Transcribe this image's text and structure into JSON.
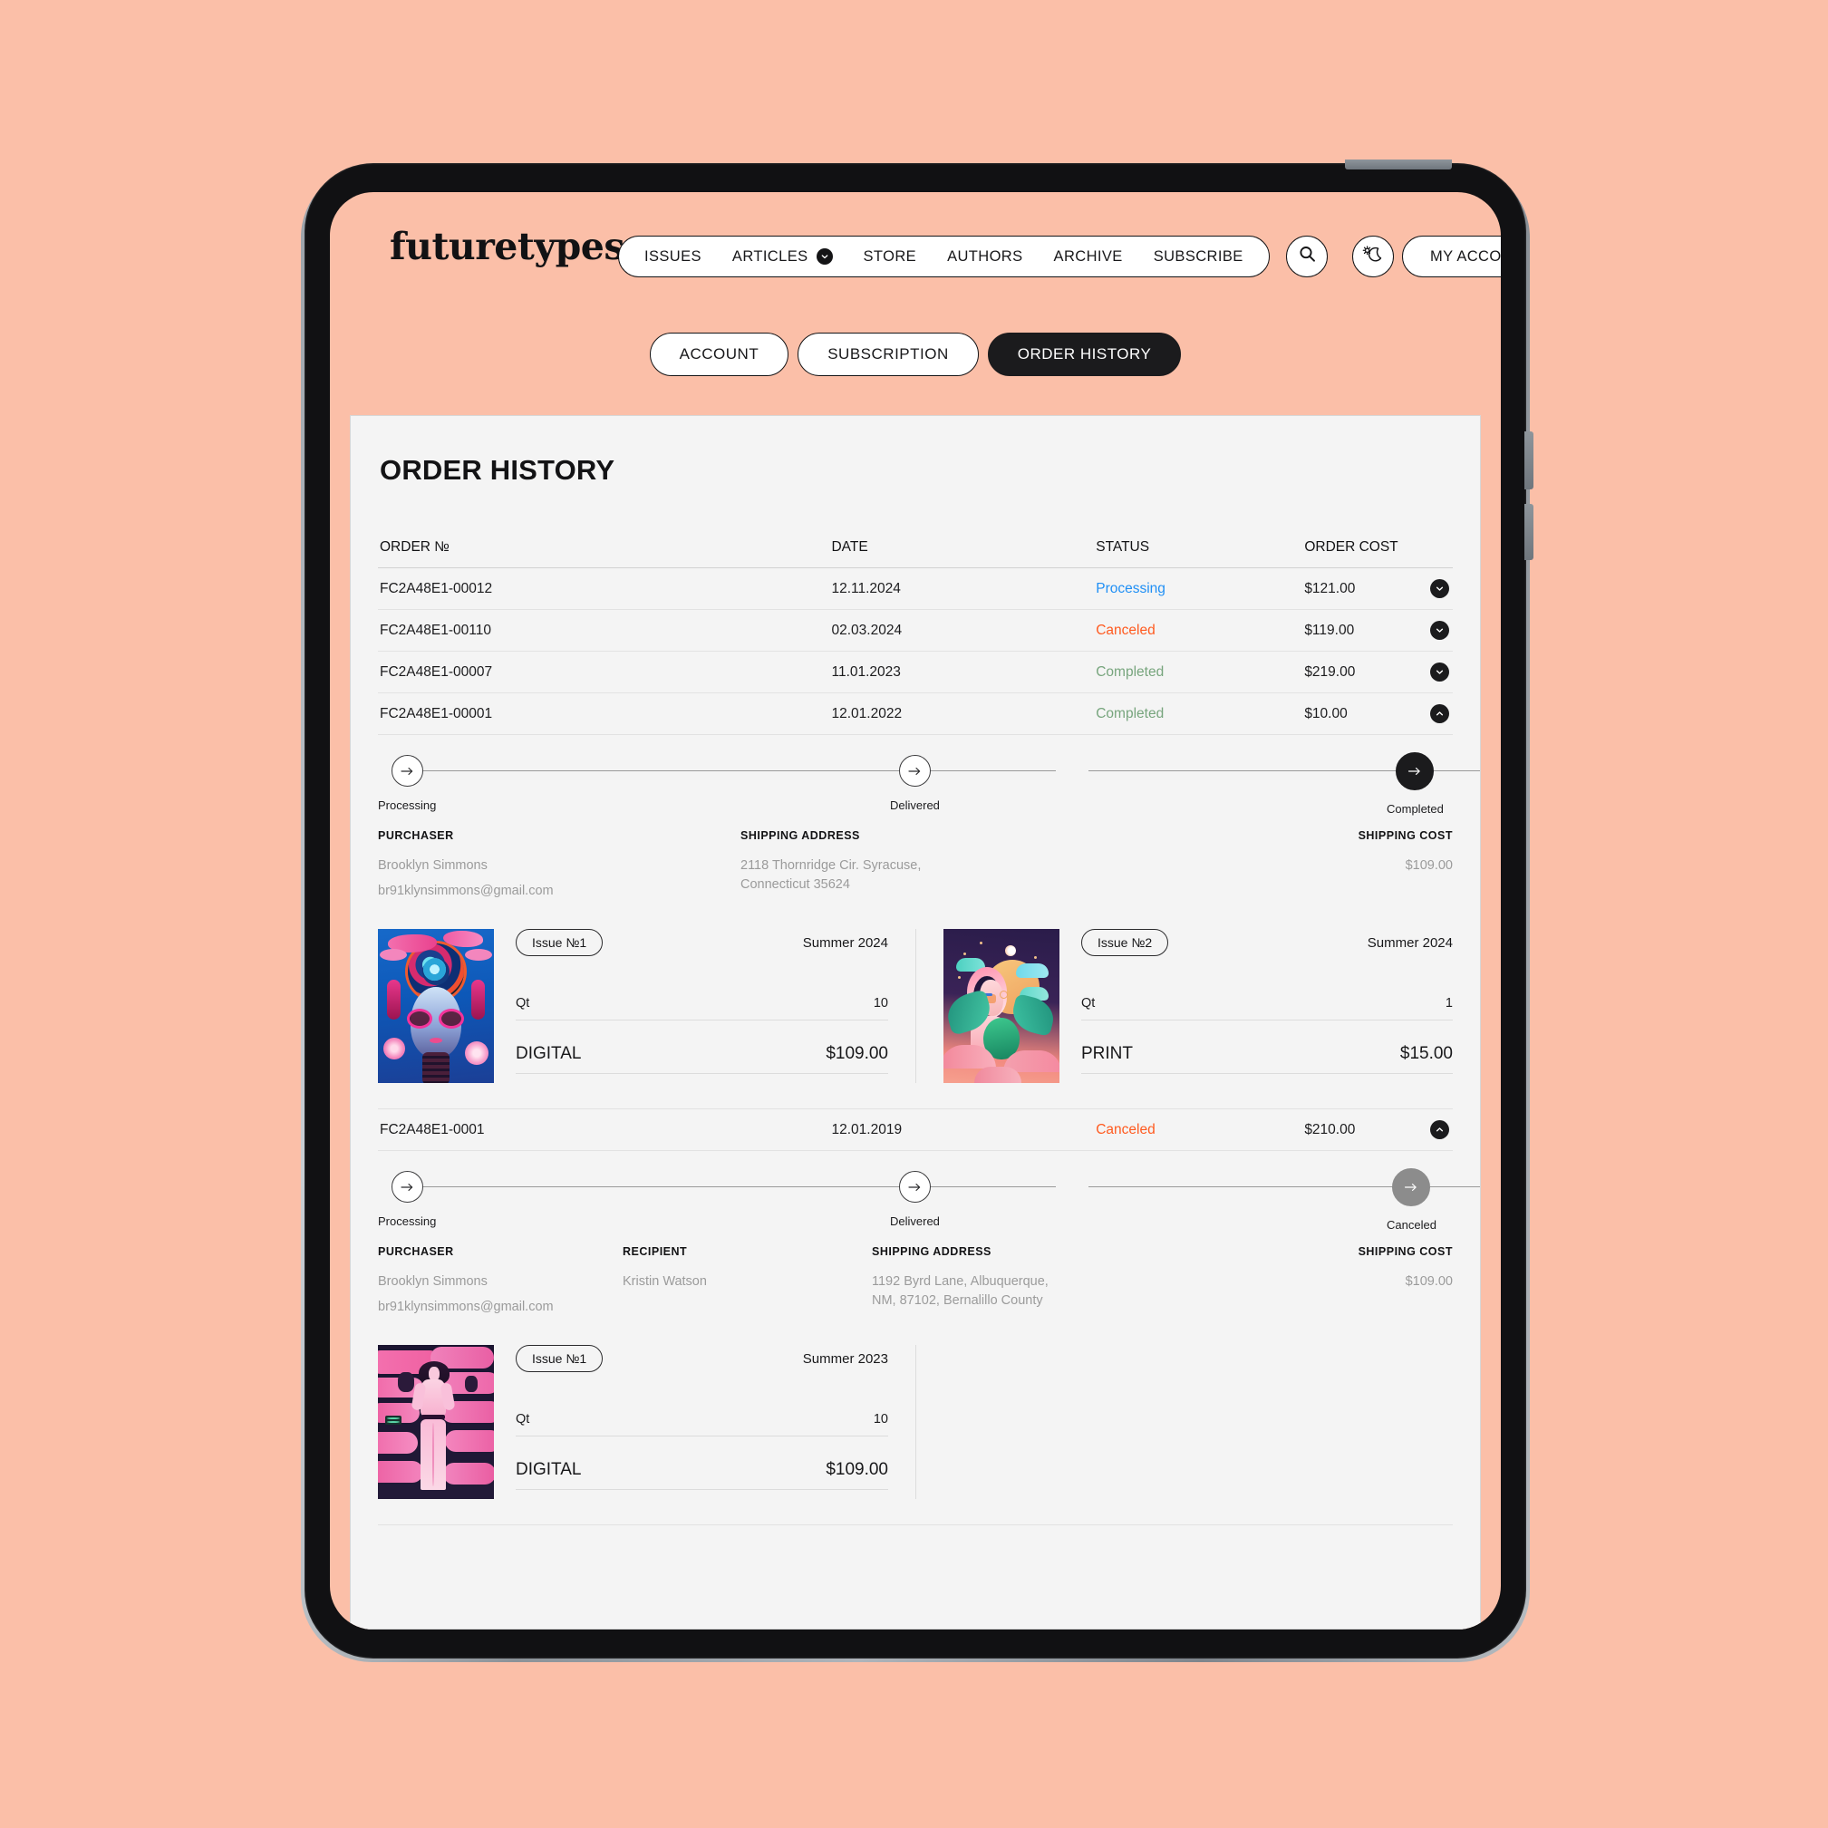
{
  "brand": "futuretypes",
  "nav": {
    "links": [
      {
        "label": "ISSUES",
        "has_chevron": false
      },
      {
        "label": "ARTICLES",
        "has_chevron": true
      },
      {
        "label": "STORE",
        "has_chevron": false
      },
      {
        "label": "AUTHORS",
        "has_chevron": false
      },
      {
        "label": "ARCHIVE",
        "has_chevron": false
      },
      {
        "label": "SUBSCRIBE",
        "has_chevron": false
      }
    ],
    "search_icon": "search-icon",
    "theme_icon": "sun-moon-icon",
    "account_label": "MY ACCOUNT"
  },
  "tabs": [
    {
      "label": "ACCOUNT",
      "active": false
    },
    {
      "label": "SUBSCRIPTION",
      "active": false
    },
    {
      "label": "ORDER HISTORY",
      "active": true
    }
  ],
  "page_title": "ORDER HISTORY",
  "table": {
    "headers": {
      "order": "ORDER №",
      "date": "DATE",
      "status": "STATUS",
      "cost": "ORDER COST"
    },
    "rows": [
      {
        "order": "FC2A48E1-00012",
        "date": "12.11.2024",
        "status": "Processing",
        "status_kind": "processing",
        "cost": "$121.00",
        "expanded": false
      },
      {
        "order": "FC2A48E1-00110",
        "date": "02.03.2024",
        "status": "Canceled",
        "status_kind": "canceled",
        "cost": "$119.00",
        "expanded": false
      },
      {
        "order": "FC2A48E1-00007",
        "date": "11.01.2023",
        "status": "Completed",
        "status_kind": "completed",
        "cost": "$219.00",
        "expanded": false
      },
      {
        "order": "FC2A48E1-00001",
        "date": "12.01.2022",
        "status": "Completed",
        "status_kind": "completed",
        "cost": "$10.00",
        "expanded": true
      },
      {
        "order": "FC2A48E1-0001",
        "date": "12.01.2019",
        "status": "Canceled",
        "status_kind": "canceled",
        "cost": "$210.00",
        "expanded": true
      }
    ]
  },
  "colors": {
    "background": "#fbbfa8",
    "card": "#f4f4f4",
    "ink": "#1b1b1d",
    "processing": "#1f8ff5",
    "canceled": "#ff5a1f",
    "completed": "#77a57d"
  },
  "details": [
    {
      "steps": [
        {
          "label": "Processing",
          "state": "outline"
        },
        {
          "label": "Delivered",
          "state": "outline"
        },
        {
          "label": "Completed",
          "state": "filled"
        }
      ],
      "meta": [
        {
          "label": "PURCHASER",
          "values": [
            "Brooklyn Simmons",
            "br91klynsimmons@gmail.com"
          ]
        },
        {
          "label": "SHIPPING ADDRESS",
          "values": [
            "2118 Thornridge Cir. Syracuse,",
            "Connecticut 35624"
          ]
        },
        {
          "label": "SHIPPING COST",
          "values": [
            "$109.00"
          ]
        }
      ],
      "items": [
        {
          "issue": "Issue №1",
          "season": "Summer 2024",
          "qt_label": "Qt",
          "qt": "10",
          "format": "DIGITAL",
          "price": "$109.00",
          "cover": "cov-a"
        },
        {
          "issue": "Issue №2",
          "season": "Summer 2024",
          "qt_label": "Qt",
          "qt": "1",
          "format": "PRINT",
          "price": "$15.00",
          "cover": "cov-b"
        }
      ]
    },
    {
      "steps": [
        {
          "label": "Processing",
          "state": "outline"
        },
        {
          "label": "Delivered",
          "state": "outline"
        },
        {
          "label": "Canceled",
          "state": "grey"
        }
      ],
      "meta": [
        {
          "label": "PURCHASER",
          "values": [
            "Brooklyn Simmons",
            "br91klynsimmons@gmail.com"
          ]
        },
        {
          "label": "RECIPIENT",
          "values": [
            "Kristin Watson"
          ]
        },
        {
          "label": "SHIPPING ADDRESS",
          "values": [
            "1192 Byrd Lane, Albuquerque,",
            "NM, 87102, Bernalillo County"
          ]
        },
        {
          "label": "SHIPPING COST",
          "values": [
            "$109.00"
          ]
        }
      ],
      "items": [
        {
          "issue": "Issue №1",
          "season": "Summer 2023",
          "qt_label": "Qt",
          "qt": "10",
          "format": "DIGITAL",
          "price": "$109.00",
          "cover": "cov-c"
        }
      ]
    }
  ]
}
